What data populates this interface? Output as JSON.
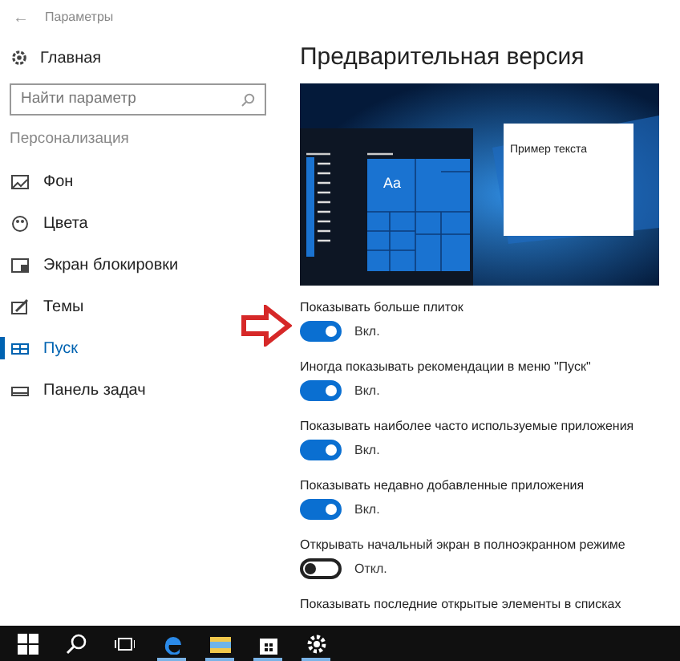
{
  "window": {
    "title": "Параметры",
    "back": "←"
  },
  "sidebar": {
    "home": "Главная",
    "search": {
      "placeholder": "Найти параметр"
    },
    "section": "Персонализация",
    "items": [
      {
        "kind": "background",
        "label": "Фон",
        "selected": false
      },
      {
        "kind": "colors",
        "label": "Цвета",
        "selected": false
      },
      {
        "kind": "lock",
        "label": "Экран блокировки",
        "selected": false
      },
      {
        "kind": "themes",
        "label": "Темы",
        "selected": false
      },
      {
        "kind": "start",
        "label": "Пуск",
        "selected": true
      },
      {
        "kind": "taskbar",
        "label": "Панель задач",
        "selected": false
      }
    ]
  },
  "content": {
    "heading": "Предварительная версия",
    "preview": {
      "tile_label": "Aa",
      "sample_text": "Пример текста"
    },
    "settings": [
      {
        "label": "Показывать больше плиток",
        "on": true,
        "state": "Вкл.",
        "highlighted": true
      },
      {
        "label": "Иногда показывать рекомендации в меню \"Пуск\"",
        "on": true,
        "state": "Вкл.",
        "highlighted": false
      },
      {
        "label": "Показывать наиболее часто используемые приложения",
        "on": true,
        "state": "Вкл.",
        "highlighted": false
      },
      {
        "label": "Показывать недавно добавленные приложения",
        "on": true,
        "state": "Вкл.",
        "highlighted": false
      },
      {
        "label": "Открывать начальный экран в полноэкранном режиме",
        "on": false,
        "state": "Откл.",
        "highlighted": false
      },
      {
        "label": "Показывать последние открытые элементы в списках"
      }
    ]
  },
  "taskbar": [
    {
      "kind": "start",
      "running": false
    },
    {
      "kind": "search",
      "running": false
    },
    {
      "kind": "taskview",
      "running": false
    },
    {
      "kind": "edge",
      "running": true
    },
    {
      "kind": "explorer",
      "running": true
    },
    {
      "kind": "store",
      "running": true
    },
    {
      "kind": "settings",
      "running": true
    }
  ]
}
